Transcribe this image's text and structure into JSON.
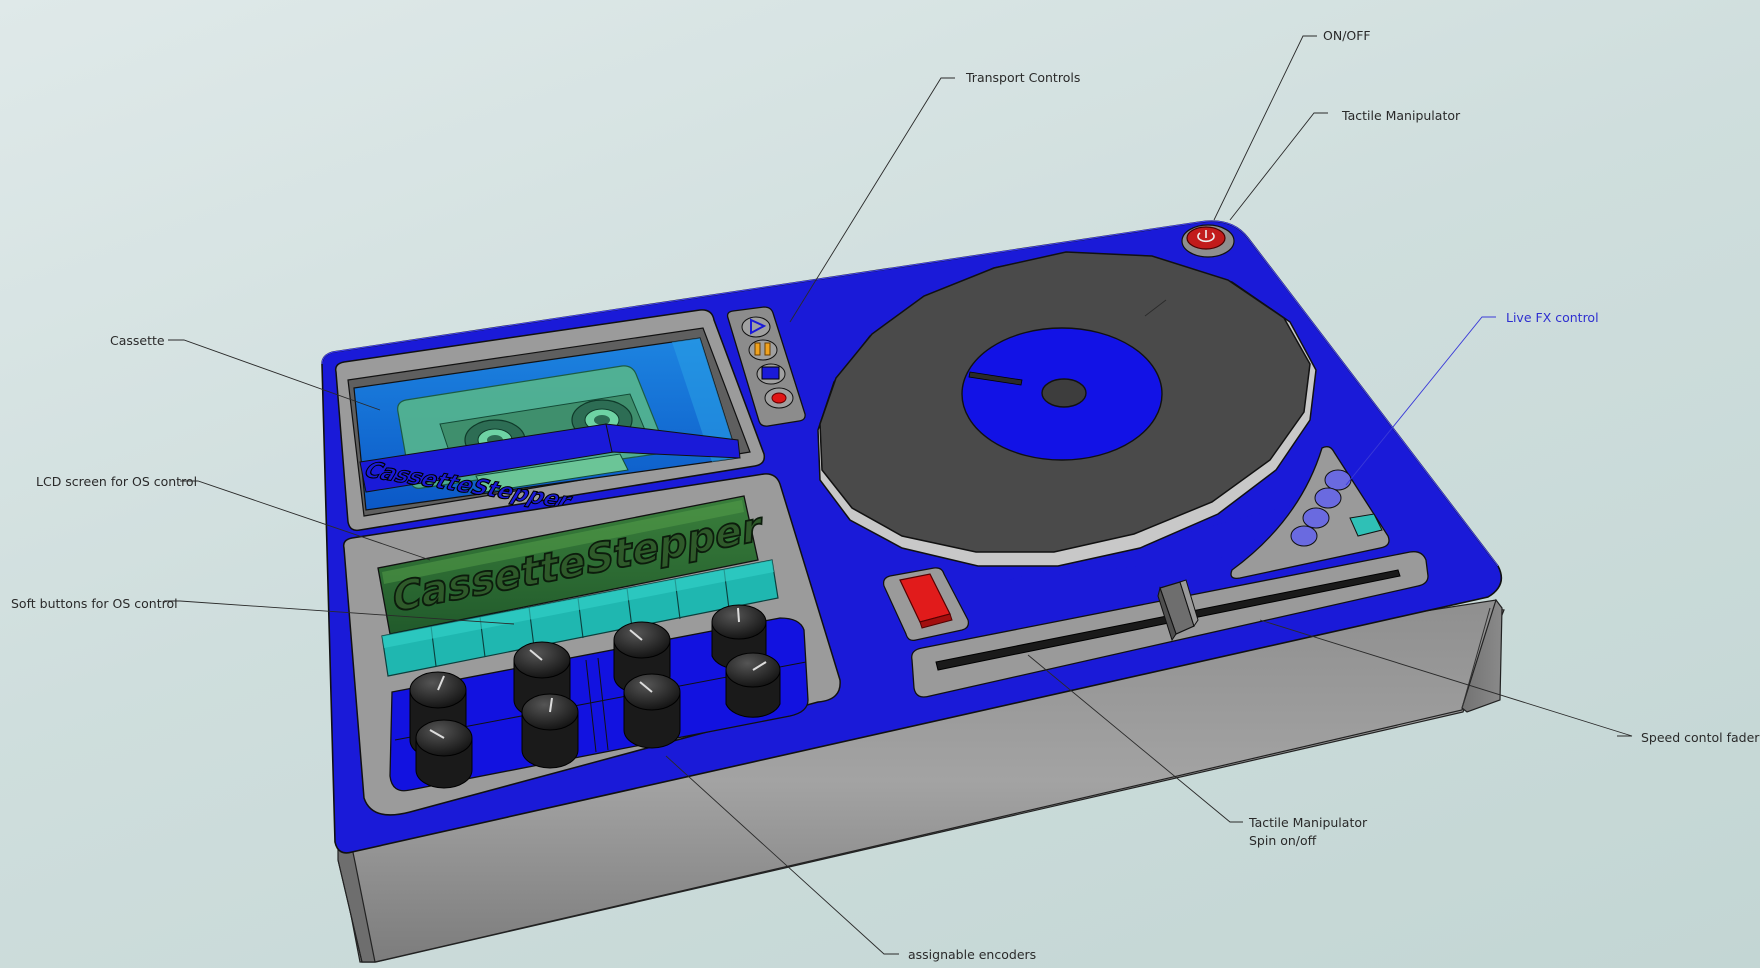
{
  "device": {
    "cassette_brand": "CassetteStepper",
    "lcd_text": "CassetteStepper"
  },
  "callouts": {
    "cassette": "Cassette",
    "lcd_screen": "LCD screen for OS control",
    "soft_buttons": "Soft buttons for OS control",
    "transport_controls": "Transport Controls",
    "on_off": "ON/OFF",
    "tactile_manipulator_top": "Tactile Manipulator",
    "live_fx": "Live FX control",
    "speed_fader": "Speed contol fader",
    "tactile_manipulator_spin_line1": "Tactile Manipulator",
    "tactile_manipulator_spin_line2": "Spin on/off",
    "assignable_encoders": "assignable encoders"
  },
  "colors": {
    "body_blue": "#1a1ad8",
    "platter_gray": "#4a4a4a",
    "lcd_green": "#2f6f3a",
    "soft_button_teal": "#1fb7b0",
    "spin_button_red": "#e11b1b",
    "live_fx_button": "#6a6ae0",
    "accent_callout_blue": "#2f2fd0"
  },
  "icons": {
    "transport": [
      "play-icon",
      "pause-icon",
      "stop-icon",
      "record-icon"
    ],
    "power": "power-icon"
  }
}
